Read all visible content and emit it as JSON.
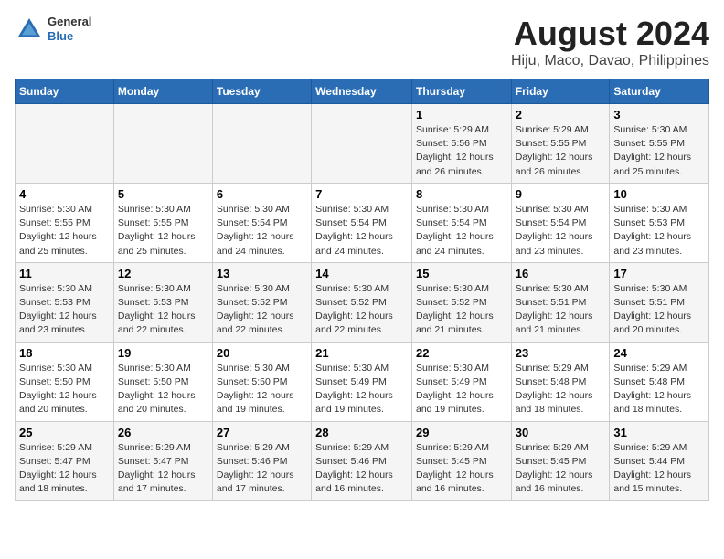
{
  "header": {
    "logo_general": "General",
    "logo_blue": "Blue",
    "title": "August 2024",
    "subtitle": "Hiju, Maco, Davao, Philippines"
  },
  "weekdays": [
    "Sunday",
    "Monday",
    "Tuesday",
    "Wednesday",
    "Thursday",
    "Friday",
    "Saturday"
  ],
  "rows": [
    [
      {
        "day": "",
        "info": ""
      },
      {
        "day": "",
        "info": ""
      },
      {
        "day": "",
        "info": ""
      },
      {
        "day": "",
        "info": ""
      },
      {
        "day": "1",
        "info": "Sunrise: 5:29 AM\nSunset: 5:56 PM\nDaylight: 12 hours\nand 26 minutes."
      },
      {
        "day": "2",
        "info": "Sunrise: 5:29 AM\nSunset: 5:55 PM\nDaylight: 12 hours\nand 26 minutes."
      },
      {
        "day": "3",
        "info": "Sunrise: 5:30 AM\nSunset: 5:55 PM\nDaylight: 12 hours\nand 25 minutes."
      }
    ],
    [
      {
        "day": "4",
        "info": "Sunrise: 5:30 AM\nSunset: 5:55 PM\nDaylight: 12 hours\nand 25 minutes."
      },
      {
        "day": "5",
        "info": "Sunrise: 5:30 AM\nSunset: 5:55 PM\nDaylight: 12 hours\nand 25 minutes."
      },
      {
        "day": "6",
        "info": "Sunrise: 5:30 AM\nSunset: 5:54 PM\nDaylight: 12 hours\nand 24 minutes."
      },
      {
        "day": "7",
        "info": "Sunrise: 5:30 AM\nSunset: 5:54 PM\nDaylight: 12 hours\nand 24 minutes."
      },
      {
        "day": "8",
        "info": "Sunrise: 5:30 AM\nSunset: 5:54 PM\nDaylight: 12 hours\nand 24 minutes."
      },
      {
        "day": "9",
        "info": "Sunrise: 5:30 AM\nSunset: 5:54 PM\nDaylight: 12 hours\nand 23 minutes."
      },
      {
        "day": "10",
        "info": "Sunrise: 5:30 AM\nSunset: 5:53 PM\nDaylight: 12 hours\nand 23 minutes."
      }
    ],
    [
      {
        "day": "11",
        "info": "Sunrise: 5:30 AM\nSunset: 5:53 PM\nDaylight: 12 hours\nand 23 minutes."
      },
      {
        "day": "12",
        "info": "Sunrise: 5:30 AM\nSunset: 5:53 PM\nDaylight: 12 hours\nand 22 minutes."
      },
      {
        "day": "13",
        "info": "Sunrise: 5:30 AM\nSunset: 5:52 PM\nDaylight: 12 hours\nand 22 minutes."
      },
      {
        "day": "14",
        "info": "Sunrise: 5:30 AM\nSunset: 5:52 PM\nDaylight: 12 hours\nand 22 minutes."
      },
      {
        "day": "15",
        "info": "Sunrise: 5:30 AM\nSunset: 5:52 PM\nDaylight: 12 hours\nand 21 minutes."
      },
      {
        "day": "16",
        "info": "Sunrise: 5:30 AM\nSunset: 5:51 PM\nDaylight: 12 hours\nand 21 minutes."
      },
      {
        "day": "17",
        "info": "Sunrise: 5:30 AM\nSunset: 5:51 PM\nDaylight: 12 hours\nand 20 minutes."
      }
    ],
    [
      {
        "day": "18",
        "info": "Sunrise: 5:30 AM\nSunset: 5:50 PM\nDaylight: 12 hours\nand 20 minutes."
      },
      {
        "day": "19",
        "info": "Sunrise: 5:30 AM\nSunset: 5:50 PM\nDaylight: 12 hours\nand 20 minutes."
      },
      {
        "day": "20",
        "info": "Sunrise: 5:30 AM\nSunset: 5:50 PM\nDaylight: 12 hours\nand 19 minutes."
      },
      {
        "day": "21",
        "info": "Sunrise: 5:30 AM\nSunset: 5:49 PM\nDaylight: 12 hours\nand 19 minutes."
      },
      {
        "day": "22",
        "info": "Sunrise: 5:30 AM\nSunset: 5:49 PM\nDaylight: 12 hours\nand 19 minutes."
      },
      {
        "day": "23",
        "info": "Sunrise: 5:29 AM\nSunset: 5:48 PM\nDaylight: 12 hours\nand 18 minutes."
      },
      {
        "day": "24",
        "info": "Sunrise: 5:29 AM\nSunset: 5:48 PM\nDaylight: 12 hours\nand 18 minutes."
      }
    ],
    [
      {
        "day": "25",
        "info": "Sunrise: 5:29 AM\nSunset: 5:47 PM\nDaylight: 12 hours\nand 18 minutes."
      },
      {
        "day": "26",
        "info": "Sunrise: 5:29 AM\nSunset: 5:47 PM\nDaylight: 12 hours\nand 17 minutes."
      },
      {
        "day": "27",
        "info": "Sunrise: 5:29 AM\nSunset: 5:46 PM\nDaylight: 12 hours\nand 17 minutes."
      },
      {
        "day": "28",
        "info": "Sunrise: 5:29 AM\nSunset: 5:46 PM\nDaylight: 12 hours\nand 16 minutes."
      },
      {
        "day": "29",
        "info": "Sunrise: 5:29 AM\nSunset: 5:45 PM\nDaylight: 12 hours\nand 16 minutes."
      },
      {
        "day": "30",
        "info": "Sunrise: 5:29 AM\nSunset: 5:45 PM\nDaylight: 12 hours\nand 16 minutes."
      },
      {
        "day": "31",
        "info": "Sunrise: 5:29 AM\nSunset: 5:44 PM\nDaylight: 12 hours\nand 15 minutes."
      }
    ]
  ]
}
